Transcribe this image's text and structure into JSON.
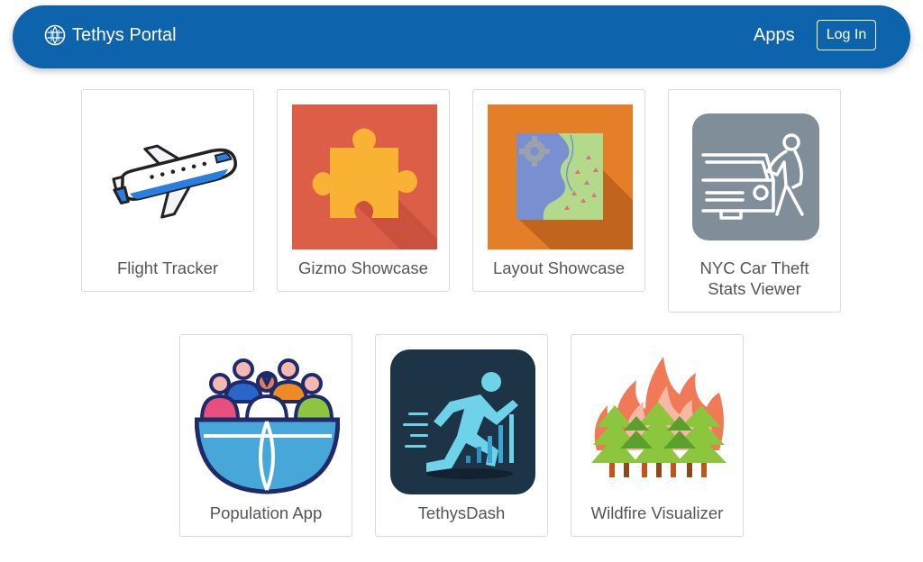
{
  "navbar": {
    "brand": "Tethys Portal",
    "apps_link": "Apps",
    "login_button": "Log In",
    "background_color": "#0d63ac"
  },
  "apps": [
    {
      "name": "Flight Tracker",
      "icon": "airplane-icon"
    },
    {
      "name": "Gizmo Showcase",
      "icon": "puzzle-piece-icon",
      "icon_bg": "#dd5e47"
    },
    {
      "name": "Layout Showcase",
      "icon": "map-gear-icon",
      "icon_bg": "#e57f27"
    },
    {
      "name": "NYC Car Theft Stats Viewer",
      "icon": "car-theft-icon",
      "icon_bg": "#7f8e98"
    },
    {
      "name": "Population App",
      "icon": "population-globe-icon"
    },
    {
      "name": "TethysDash",
      "icon": "runner-icon",
      "icon_bg": "#1d3346"
    },
    {
      "name": "Wildfire Visualizer",
      "icon": "forest-fire-icon"
    }
  ]
}
